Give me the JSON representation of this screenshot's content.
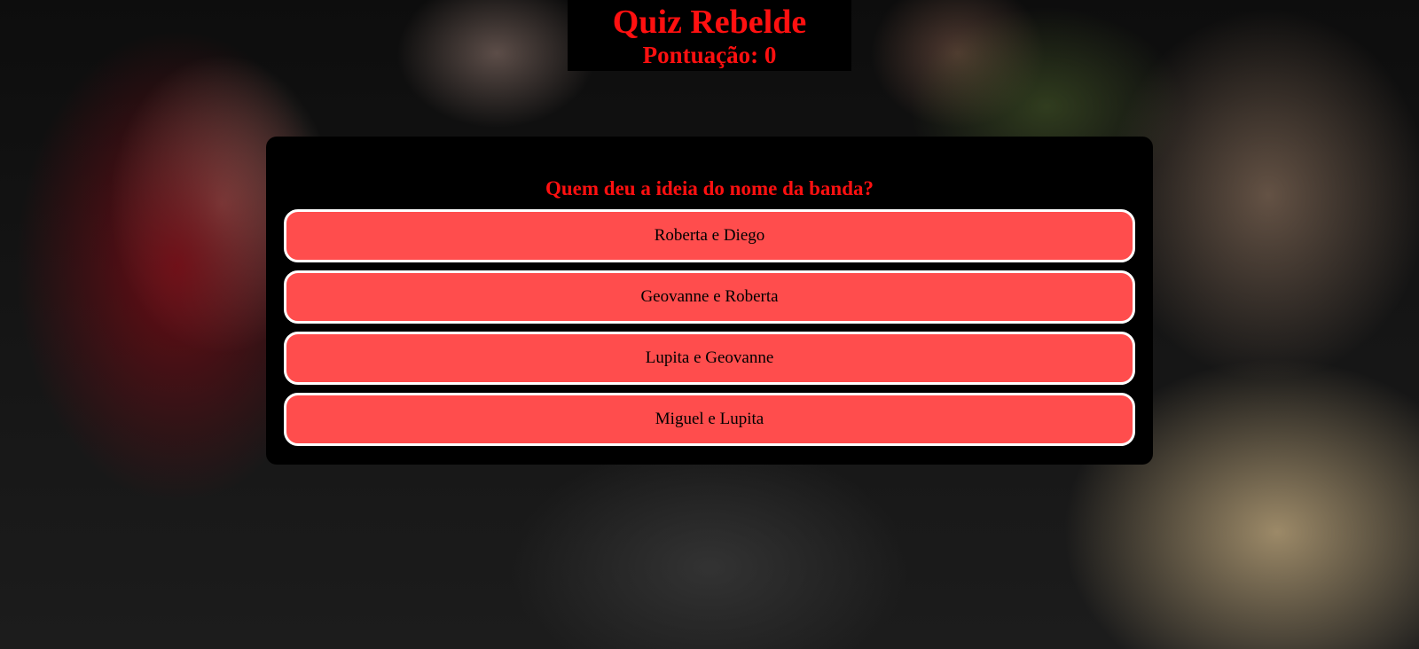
{
  "header": {
    "title": "Quiz Rebelde",
    "score_label": "Pontuação: 0"
  },
  "quiz": {
    "question": "Quem deu a ideia do nome da banda?",
    "answers": [
      "Roberta e Diego",
      "Geovanne e Roberta",
      "Lupita e Geovanne",
      "Miguel e Lupita"
    ]
  },
  "colors": {
    "accent_red": "#ff1010",
    "answer_bg": "#ff4d4d",
    "answer_border": "#ffffff",
    "panel_bg": "#000000"
  }
}
